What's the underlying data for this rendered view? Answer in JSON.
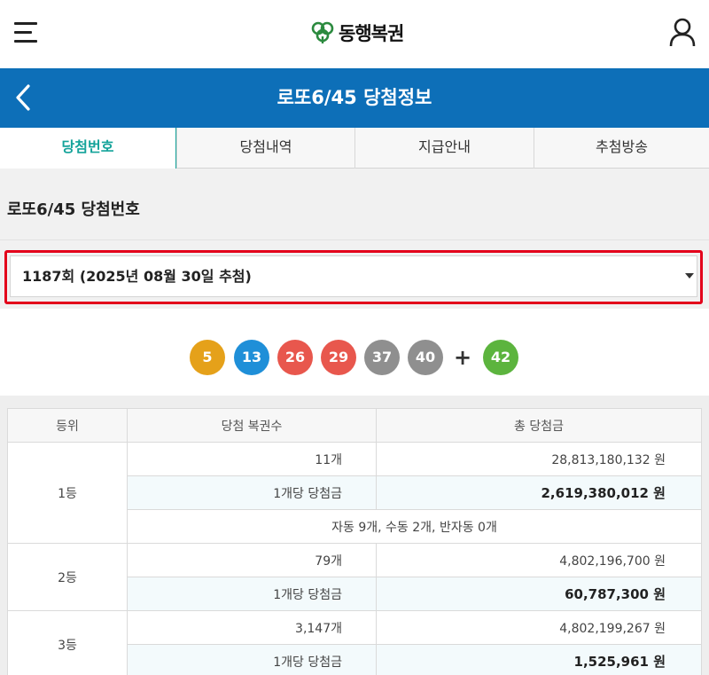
{
  "header": {
    "logo_text": "동행복권",
    "logo_mark": "clover-logo",
    "menu_icon": "hamburger-menu-icon",
    "user_icon": "user-icon"
  },
  "titlebar": {
    "title": "로또6/45 당첨정보",
    "back_icon": "chevron-left-icon",
    "bg_color": "#0d6fb8"
  },
  "tabs": [
    {
      "label": "당첨번호",
      "active": true
    },
    {
      "label": "당첨내역",
      "active": false
    },
    {
      "label": "지급안내",
      "active": false
    },
    {
      "label": "추첨방송",
      "active": false
    }
  ],
  "section": {
    "title": "로또6/45 당첨번호",
    "selected_draw": "1187회 (2025년 08월 30일 추첨)"
  },
  "numbers": {
    "main": [
      {
        "value": "5",
        "color": "#e5a11a"
      },
      {
        "value": "13",
        "color": "#1f8fd8"
      },
      {
        "value": "26",
        "color": "#e8574d"
      },
      {
        "value": "29",
        "color": "#e8574d"
      },
      {
        "value": "37",
        "color": "#8f8f8f"
      },
      {
        "value": "40",
        "color": "#8f8f8f"
      }
    ],
    "plus": "+",
    "bonus": {
      "value": "42",
      "color": "#5cb43e"
    }
  },
  "table": {
    "headers": [
      "등위",
      "당첨 복권수",
      "총 당첨금"
    ],
    "rows": [
      {
        "rank": "1등",
        "winners": "11개",
        "total": "28,813,180,132 원",
        "per_label": "1개당 당첨금",
        "per_amount": "2,619,380,012 원",
        "note": "자동 9개, 수동 2개, 반자동 0개"
      },
      {
        "rank": "2등",
        "winners": "79개",
        "total": "4,802,196,700 원",
        "per_label": "1개당 당첨금",
        "per_amount": "60,787,300 원"
      },
      {
        "rank": "3등",
        "winners": "3,147개",
        "total": "4,802,199,267 원",
        "per_label": "1개당 당첨금",
        "per_amount": "1,525,961 원"
      }
    ]
  }
}
